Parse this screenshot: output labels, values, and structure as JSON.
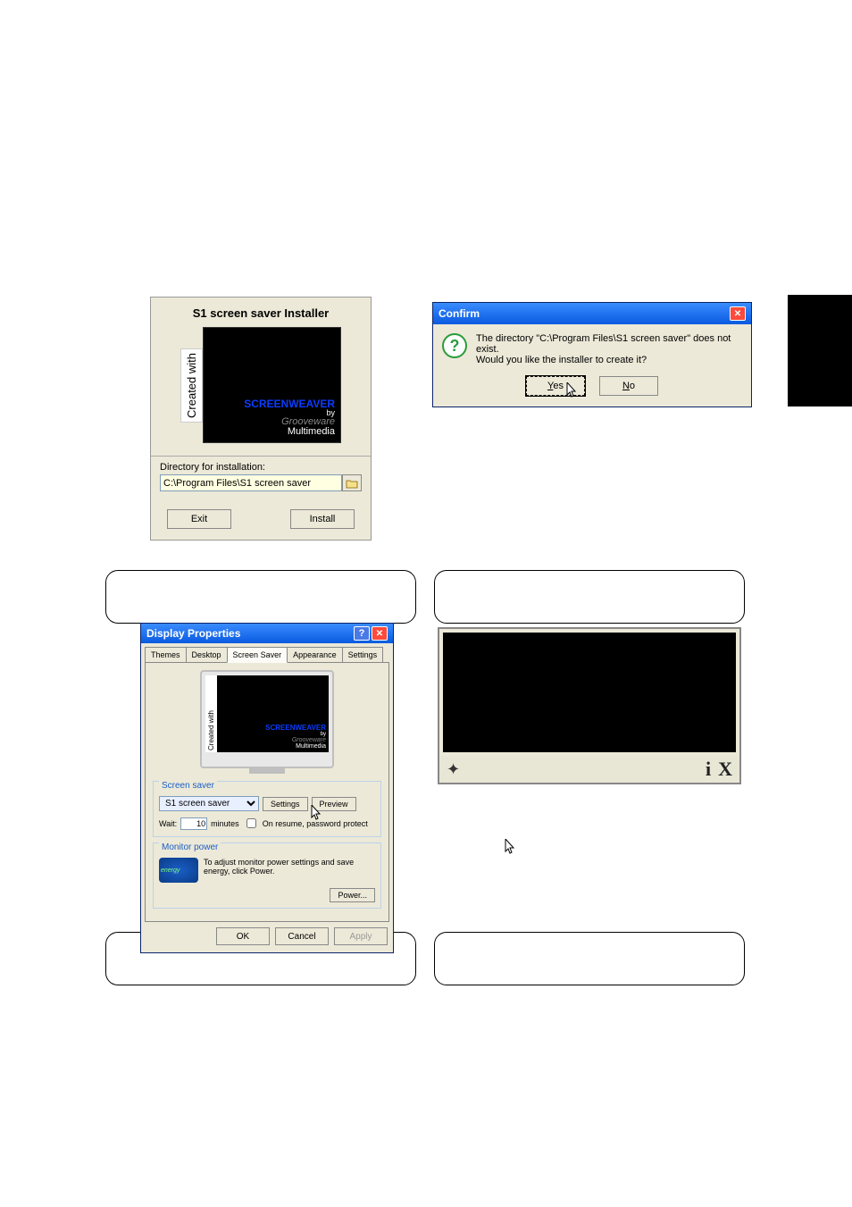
{
  "installer": {
    "title": "S1 screen saver Installer",
    "created_with": "Created with",
    "preview": {
      "screenweaver": "SCREENWEAVER",
      "by": "by",
      "grooveware": "Grooveware",
      "multimedia": "Multimedia"
    },
    "directory_label": "Directory for installation:",
    "directory_value": "C:\\Program Files\\S1 screen saver",
    "exit_btn": "Exit",
    "install_btn": "Install"
  },
  "confirm": {
    "title": "Confirm",
    "message_line1": "The directory \"C:\\Program Files\\S1 screen saver\" does not exist.",
    "message_line2": "Would you like the installer to create it?",
    "yes_btn": "Yes",
    "no_btn": "No"
  },
  "display_props": {
    "title": "Display Properties",
    "tabs": {
      "themes": "Themes",
      "desktop": "Desktop",
      "screensaver": "Screen Saver",
      "appearance": "Appearance",
      "settings": "Settings"
    },
    "preview": {
      "created_with": "Created with",
      "screenweaver": "SCREENWEAVER",
      "by": "by",
      "grooveware": "Grooveware",
      "multimedia": "Multimedia"
    },
    "screensaver_legend": "Screen saver",
    "ss_selected": "S1 screen saver",
    "settings_btn": "Settings",
    "preview_btn": "Preview",
    "wait_label": "Wait:",
    "wait_value": "10",
    "minutes_label": "minutes",
    "resume_label": "On resume, password protect",
    "monitor_power_legend": "Monitor power",
    "monitor_power_text": "To adjust monitor power settings and save energy, click Power.",
    "power_btn": "Power...",
    "energy_text": "energy",
    "ok_btn": "OK",
    "cancel_btn": "Cancel",
    "apply_btn": "Apply"
  },
  "ss_preview": {
    "info_icon": "i",
    "close_icon": "X"
  }
}
